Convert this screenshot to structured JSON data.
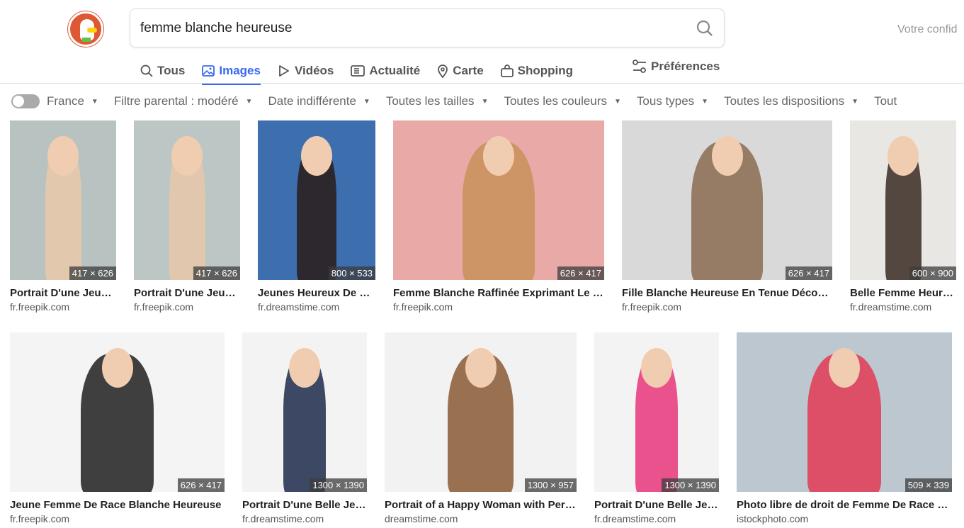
{
  "search": {
    "query": "femme blanche heureuse"
  },
  "header": {
    "privacy_text": "Votre confid"
  },
  "tabs": [
    {
      "label": "Tous",
      "icon": "search-icon"
    },
    {
      "label": "Images",
      "icon": "image-icon",
      "active": true
    },
    {
      "label": "Vidéos",
      "icon": "play-icon"
    },
    {
      "label": "Actualité",
      "icon": "news-icon"
    },
    {
      "label": "Carte",
      "icon": "map-pin-icon"
    },
    {
      "label": "Shopping",
      "icon": "shopping-bag-icon"
    }
  ],
  "preferences_label": "Préférences",
  "filters": {
    "region": "France",
    "items": [
      "Filtre parental : modéré",
      "Date indifférente",
      "Toutes les tailles",
      "Toutes les couleurs",
      "Tous types",
      "Toutes les dispositions",
      "Tout"
    ]
  },
  "colors": {
    "accent": "#3969ef",
    "logo": "#de5833"
  },
  "results": [
    {
      "title": "Portrait D'une Jeune Femme",
      "source": "fr.freepik.com",
      "size": "417 × 626",
      "bg": "#b8c3c1",
      "fig": "#e9c9a8"
    },
    {
      "title": "Portrait D'une Jeune Femme",
      "source": "fr.freepik.com",
      "size": "417 × 626",
      "bg": "#bcc6c4",
      "fig": "#e6c7a9"
    },
    {
      "title": "Jeunes Heureux De Femme",
      "source": "fr.dreamstime.com",
      "size": "800 × 533",
      "bg": "#3d6eae",
      "fig": "#2a1c18"
    },
    {
      "title": "Femme Blanche Raffinée Exprimant Le Bonheur",
      "source": "fr.freepik.com",
      "size": "626 × 417",
      "bg": "#e9a9a7",
      "fig": "#c8915a"
    },
    {
      "title": "Fille Blanche Heureuse En Tenue Décontractée",
      "source": "fr.freepik.com",
      "size": "626 × 417",
      "bg": "#d9d9d9",
      "fig": "#8a6a50"
    },
    {
      "title": "Belle Femme Heureuse",
      "source": "fr.dreamstime.com",
      "size": "600 × 900",
      "bg": "#e9e7e4",
      "fig": "#3a2a22"
    },
    {
      "title": "Jeune Femme De Race Blanche Heureuse",
      "source": "fr.freepik.com",
      "size": "626 × 417",
      "bg": "#f4f4f4",
      "fig": "#1f1f1f"
    },
    {
      "title": "Portrait D'une Belle Jeune Femme",
      "source": "fr.dreamstime.com",
      "size": "1300 × 1390",
      "bg": "#f3f3f3",
      "fig": "#1c2a4a"
    },
    {
      "title": "Portrait of a Happy Woman with Perfect Smile",
      "source": "dreamstime.com",
      "size": "1300 × 957",
      "bg": "#f2f2f2",
      "fig": "#8a5a35"
    },
    {
      "title": "Portrait D'une Belle Jeune Femme",
      "source": "fr.dreamstime.com",
      "size": "1300 × 1390",
      "bg": "#f3f3f3",
      "fig": "#e8357a"
    },
    {
      "title": "Photo libre de droit de Femme De Race Blanche",
      "source": "istockphoto.com",
      "size": "509 × 339",
      "bg": "#bcc7cf",
      "fig": "#e23a55"
    }
  ]
}
